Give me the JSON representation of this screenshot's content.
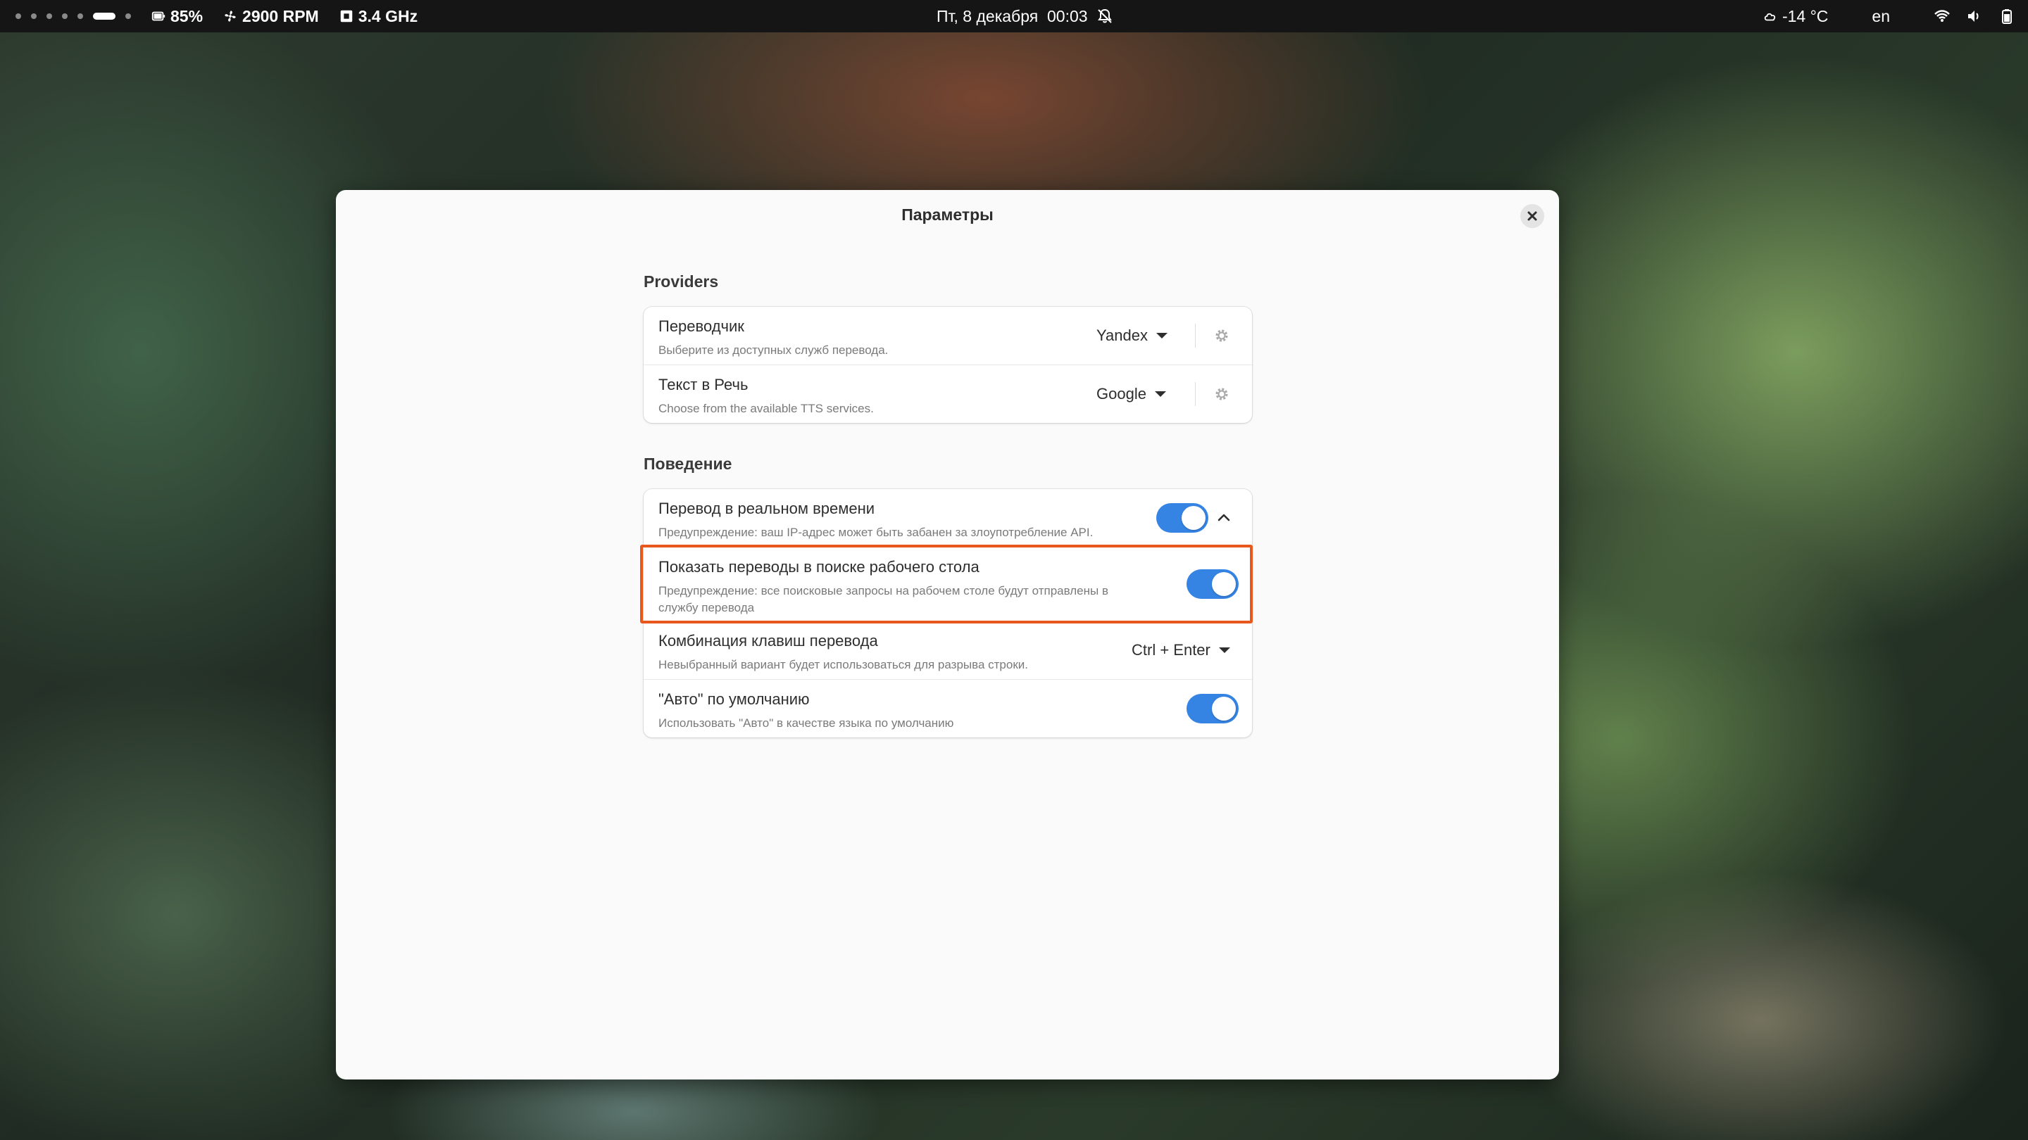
{
  "topbar": {
    "battery_percent": "85%",
    "fan_speed": "2900 RPM",
    "cpu_freq": "3.4 GHz",
    "datetime": "Пт, 8 декабря  00:03",
    "weather": "-14 °C",
    "language": "en",
    "icons": [
      "battery-icon",
      "fan-icon",
      "cpu-icon",
      "notifications-off-icon",
      "weather-cloud-icon",
      "wifi-icon",
      "volume-icon",
      "power-battery-icon"
    ]
  },
  "dialog": {
    "title": "Параметры",
    "providers": {
      "section_title": "Providers",
      "rows": [
        {
          "title": "Переводчик",
          "subtitle": "Выберите из доступных служб перевода.",
          "value": "Yandex"
        },
        {
          "title": "Текст в Речь",
          "subtitle": "Choose from the available TTS services.",
          "value": "Google"
        }
      ]
    },
    "behavior": {
      "section_title": "Поведение",
      "realtime": {
        "title": "Перевод в реальном времени",
        "subtitle": "Предупреждение: ваш IP-адрес может быть забанен за злоупотребление API.",
        "enabled": true,
        "expanded": true
      },
      "search": {
        "title": "Показать переводы в поиске рабочего стола",
        "subtitle": "Предупреждение: все поисковые запросы на рабочем столе будут отправлены в службу перевода",
        "enabled": true,
        "highlighted": true
      },
      "shortcut": {
        "title": "Комбинация клавиш перевода",
        "subtitle": "Невыбранный вариант будет использоваться для разрыва строки.",
        "value": "Ctrl + Enter"
      },
      "auto": {
        "title": "\"Авто\" по умолчанию",
        "subtitle": "Использовать \"Авто\" в качестве языка по умолчанию",
        "enabled": true
      }
    }
  },
  "colors": {
    "accent": "#3584e4",
    "highlight": "#e8571c"
  }
}
